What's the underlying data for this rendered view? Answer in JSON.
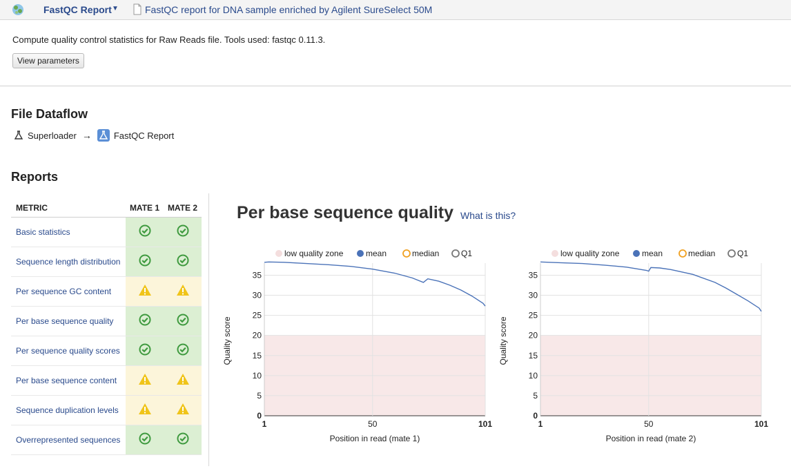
{
  "header": {
    "app_title": "FastQC Report",
    "doc_title": "FastQC report for DNA sample enriched by Agilent SureSelect 50M"
  },
  "summary": {
    "description": "Compute quality control statistics for Raw Reads file. Tools used: fastqc 0.11.3.",
    "params_button": "View parameters"
  },
  "dataflow": {
    "heading": "File Dataflow",
    "source": "Superloader",
    "arrow": "→",
    "target": "FastQC Report"
  },
  "reports": {
    "heading": "Reports",
    "columns": [
      "METRIC",
      "MATE 1",
      "MATE 2"
    ],
    "rows": [
      {
        "name": "Basic statistics",
        "mate1": "pass",
        "mate2": "pass"
      },
      {
        "name": "Sequence length distribution",
        "mate1": "pass",
        "mate2": "pass"
      },
      {
        "name": "Per sequence GC content",
        "mate1": "warn",
        "mate2": "warn"
      },
      {
        "name": "Per base sequence quality",
        "mate1": "pass",
        "mate2": "pass"
      },
      {
        "name": "Per sequence quality scores",
        "mate1": "pass",
        "mate2": "pass"
      },
      {
        "name": "Per base sequence content",
        "mate1": "warn",
        "mate2": "warn"
      },
      {
        "name": "Sequence duplication levels",
        "mate1": "warn",
        "mate2": "warn"
      },
      {
        "name": "Overrepresented sequences",
        "mate1": "pass",
        "mate2": "pass"
      }
    ]
  },
  "plot": {
    "title": "Per base sequence quality",
    "help_link": "What is this?"
  },
  "colors": {
    "link": "#2a4a8c",
    "pass_bg": "#dcefd3",
    "warn_bg": "#fcf5da",
    "pass_icon": "#3f9a3f",
    "warn_icon": "#f0c419",
    "mean_line": "#4a72b8",
    "median_marker": "#f0a020",
    "low_zone": "#f8e8e8"
  },
  "chart_data": [
    {
      "type": "line",
      "xlabel": "Position in read (mate 1)",
      "ylabel": "Quality score",
      "legend": [
        "low quality zone",
        "mean",
        "median",
        "Q1"
      ],
      "xlim": [
        1,
        101
      ],
      "ylim": [
        0,
        38
      ],
      "x_ticks": [
        "1",
        "50",
        "101"
      ],
      "y_ticks": [
        "0",
        "5",
        "10",
        "15",
        "20",
        "25",
        "30",
        "35"
      ],
      "low_quality_zone": [
        0,
        20
      ],
      "series": [
        {
          "name": "mean",
          "x": [
            1,
            3,
            10,
            20,
            30,
            40,
            50,
            60,
            68,
            73,
            75,
            80,
            85,
            90,
            95,
            100,
            101
          ],
          "y": [
            38.2,
            38.3,
            38.2,
            37.9,
            37.6,
            37.2,
            36.5,
            35.5,
            34.3,
            33.2,
            34.1,
            33.5,
            32.5,
            31.3,
            29.8,
            28.0,
            27.3
          ]
        }
      ]
    },
    {
      "type": "line",
      "xlabel": "Position in read (mate 2)",
      "ylabel": "Quality score",
      "legend": [
        "low quality zone",
        "mean",
        "median",
        "Q1"
      ],
      "xlim": [
        1,
        101
      ],
      "ylim": [
        0,
        38
      ],
      "x_ticks": [
        "1",
        "50",
        "101"
      ],
      "y_ticks": [
        "0",
        "5",
        "10",
        "15",
        "20",
        "25",
        "30",
        "35"
      ],
      "low_quality_zone": [
        0,
        20
      ],
      "series": [
        {
          "name": "mean",
          "x": [
            1,
            10,
            20,
            30,
            40,
            49,
            50,
            51,
            55,
            60,
            70,
            80,
            85,
            90,
            95,
            100,
            101
          ],
          "y": [
            38.3,
            38.1,
            37.9,
            37.5,
            37.0,
            36.2,
            36.0,
            36.9,
            36.8,
            36.4,
            35.2,
            33.2,
            31.8,
            30.2,
            28.6,
            26.8,
            26.0
          ]
        }
      ]
    }
  ]
}
